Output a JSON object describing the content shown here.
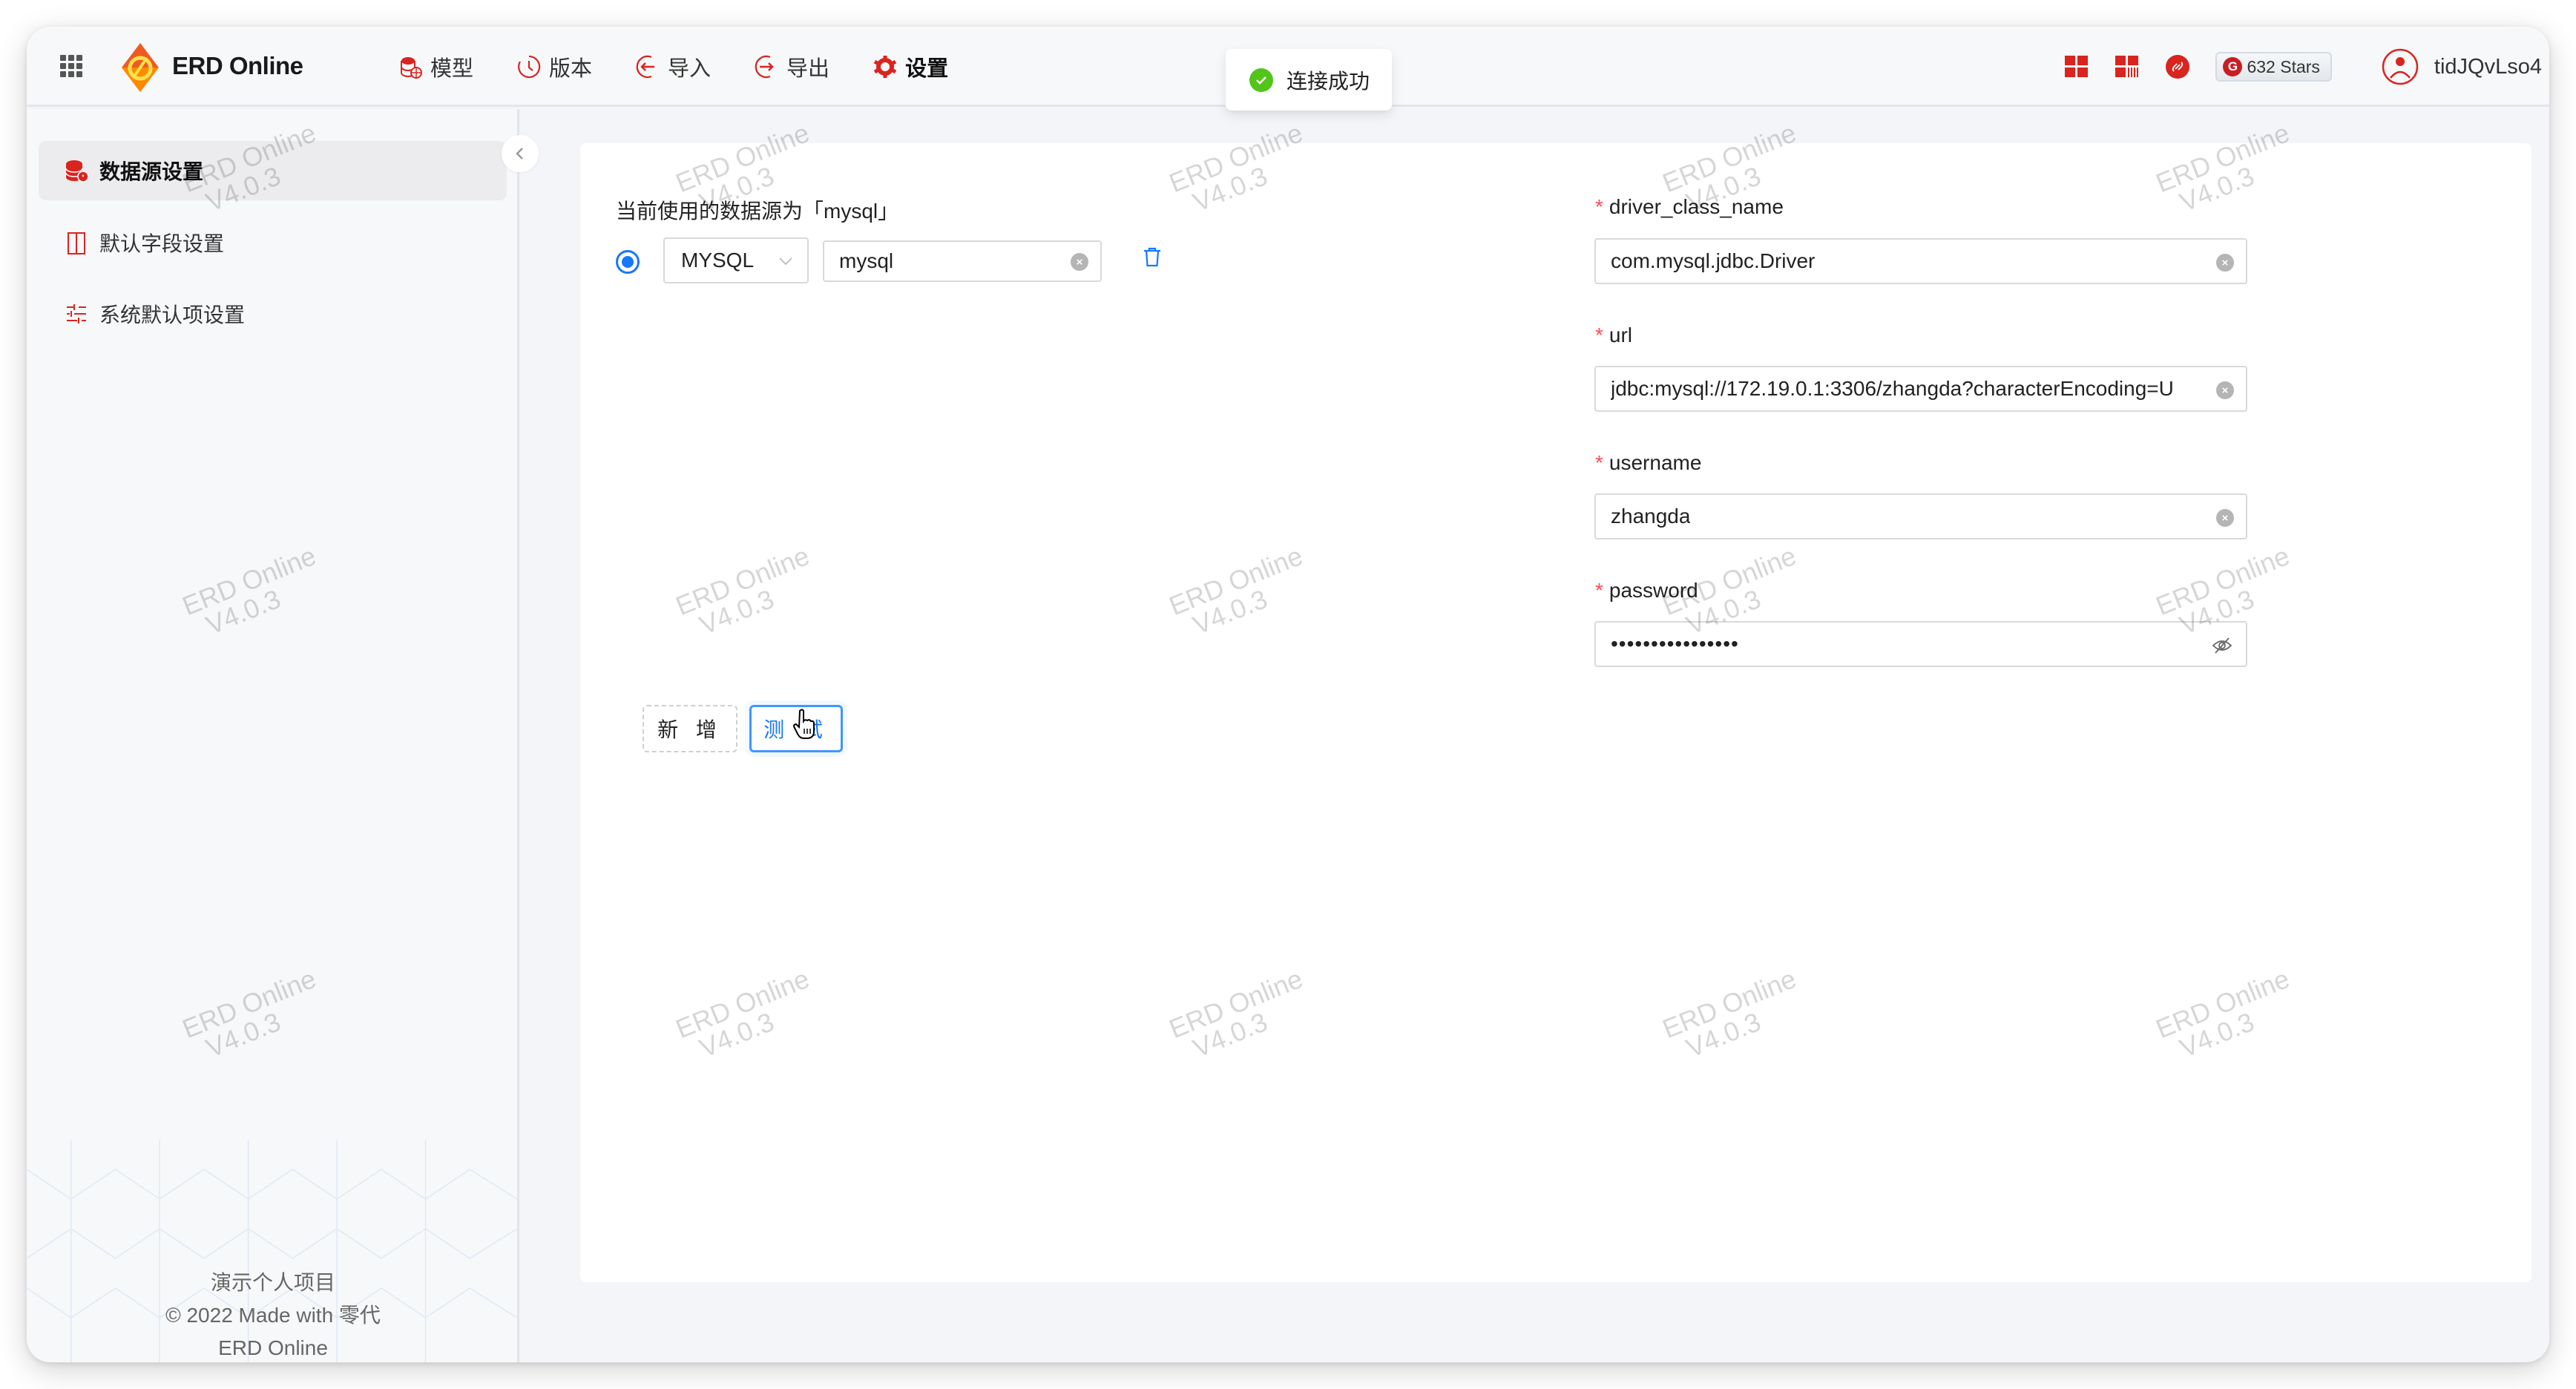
{
  "header": {
    "brand": "ERD Online",
    "nav": [
      {
        "label": "模型",
        "icon": "database-icon"
      },
      {
        "label": "版本",
        "icon": "history-icon"
      },
      {
        "label": "导入",
        "icon": "import-icon"
      },
      {
        "label": "导出",
        "icon": "export-icon"
      },
      {
        "label": "设置",
        "icon": "gear-icon",
        "active": true
      }
    ],
    "stars_label": "632 Stars",
    "gitee_glyph": "G",
    "username": "tidJQvLso4"
  },
  "toast": {
    "message": "连接成功",
    "status": "success"
  },
  "sidebar": {
    "items": [
      {
        "label": "数据源设置",
        "active": true
      },
      {
        "label": "默认字段设置"
      },
      {
        "label": "系统默认项设置"
      }
    ],
    "footer": [
      "演示个人项目",
      "© 2022 Made with 零代",
      "ERD Online"
    ]
  },
  "datasource": {
    "current_label": "当前使用的数据源为「mysql」",
    "rows": [
      {
        "selected": true,
        "type": "MYSQL",
        "name": "mysql"
      }
    ],
    "fields": [
      {
        "label": "driver_class_name",
        "required": true,
        "value": "com.mysql.jdbc.Driver"
      },
      {
        "label": "url",
        "required": true,
        "value": "jdbc:mysql://172.19.0.1:3306/zhangda?characterEncoding=U"
      },
      {
        "label": "username",
        "required": true,
        "value": "zhangda"
      },
      {
        "label": "password",
        "required": true,
        "value": "••••••••••••••••"
      }
    ],
    "add_button": "新 增",
    "test_button": "测 试"
  },
  "watermark": {
    "line1": "ERD Online",
    "line2": "V4.0.3"
  },
  "colors": {
    "accent": "#1677ff",
    "brand_red": "#d9241f",
    "success": "#52c41a",
    "required": "#ff4d4f"
  }
}
